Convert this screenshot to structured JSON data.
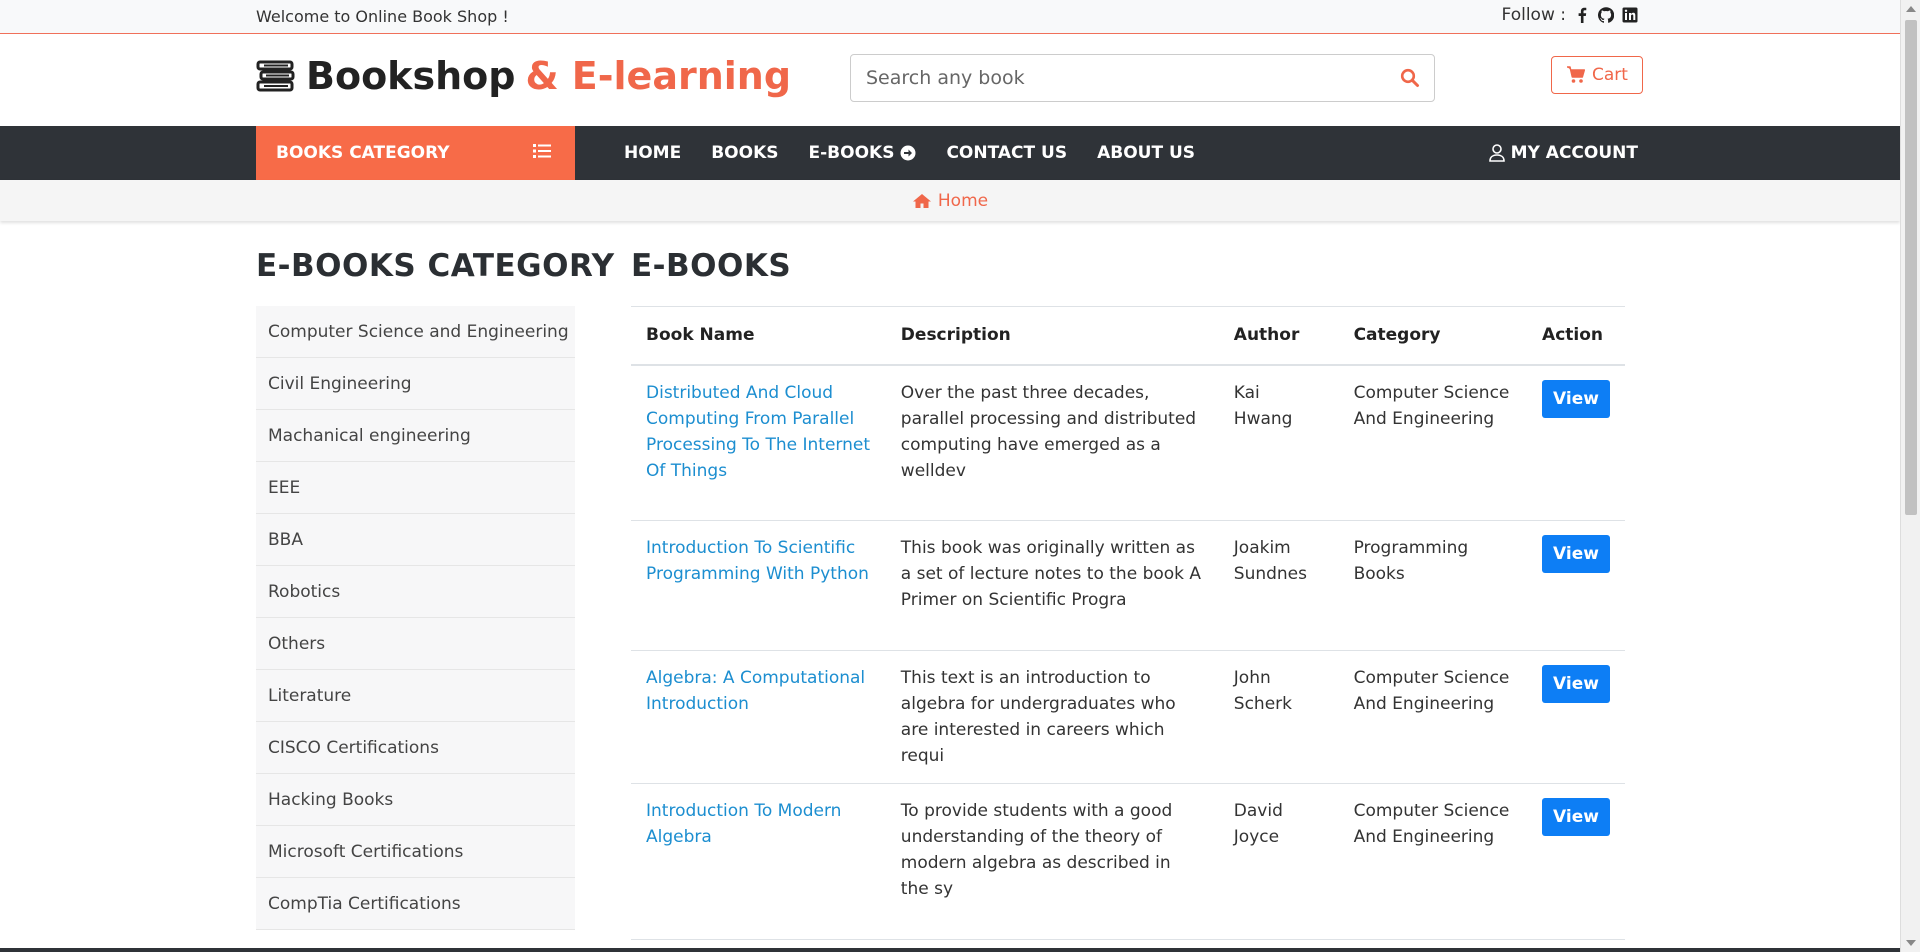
{
  "topbar": {
    "welcome": "Welcome to Online Book Shop !",
    "follow_label": "Follow :",
    "icons": [
      "facebook-icon",
      "github-icon",
      "linkedin-icon"
    ]
  },
  "header": {
    "logo_main": "Bookshop",
    "logo_accent": "& E-learning",
    "search_placeholder": "Search any book",
    "cart_label": "Cart"
  },
  "nav": {
    "category_label": "BOOKS CATEGORY",
    "items": [
      "HOME",
      "BOOKS",
      "E-BOOKS",
      "CONTACT US",
      "ABOUT US"
    ],
    "account_label": "MY ACCOUNT"
  },
  "breadcrumb": {
    "home": "Home"
  },
  "sidebar": {
    "title": "E-BOOKS CATEGORY",
    "items": [
      "Computer Science and Engineering",
      "Civil Engineering",
      "Machanical engineering",
      "EEE",
      "BBA",
      "Robotics",
      "Others",
      "Literature",
      "CISCO Certifications",
      "Hacking Books",
      "Microsoft Certifications",
      "CompTia Certifications"
    ]
  },
  "main": {
    "title": "E-BOOKS",
    "columns": [
      "Book Name",
      "Description",
      "Author",
      "Category",
      "Action"
    ],
    "rows": [
      {
        "name": "Distributed And Cloud Computing From Parallel Processing To The Internet Of Things",
        "description": "Over the past three decades, parallel processing and distributed computing have emerged as a welldev",
        "author": "Kai Hwang",
        "category": "Computer Science And Engineering",
        "action": "View"
      },
      {
        "name": "Introduction To Scientific Programming With Python",
        "description": "This book was originally written as a set of lecture notes to the book A Primer on Scientific Progra",
        "author": "Joakim Sundnes",
        "category": "Programming Books",
        "action": "View"
      },
      {
        "name": "Algebra: A Computational Introduction",
        "description": "This text is an introduction to algebra for undergraduates who are interested in careers which requi",
        "author": "John Scherk",
        "category": "Computer Science And Engineering",
        "action": "View"
      },
      {
        "name": "Introduction To Modern Algebra",
        "description": "To provide students with a good understanding of the theory of modern algebra as described in the sy",
        "author": "David Joyce",
        "category": "Computer Science And Engineering",
        "action": "View"
      }
    ]
  },
  "colors": {
    "accent": "#f76b48",
    "nav_bg": "#2f3338",
    "link": "#1c8ed0",
    "button": "#0d7ef5"
  }
}
